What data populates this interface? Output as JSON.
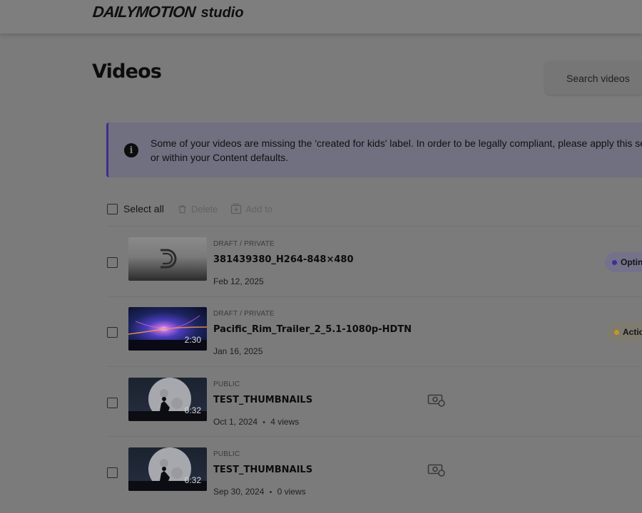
{
  "header": {
    "brand": "DAILYMOTION",
    "product": "studio"
  },
  "page": {
    "title": "Videos"
  },
  "search": {
    "placeholder": "Search videos"
  },
  "banner": {
    "icon": "info-icon",
    "text_line1": "Some of your videos are missing the 'created for kids' label. In order to be legally compliant, please apply this set",
    "text_line2": "or within your Content defaults."
  },
  "toolbar": {
    "select_all": "Select all",
    "delete": "Delete",
    "add_to": "Add to"
  },
  "videos": [
    {
      "status": "DRAFT / PRIVATE",
      "title": "381439380_H264-848×480",
      "date": "Feb 12, 2025",
      "views": "",
      "duration": "",
      "badge": "Optin",
      "badge_color": "#3b2f9e",
      "thumbnail": "dailymotion-placeholder"
    },
    {
      "status": "DRAFT / PRIVATE",
      "title": "Pacific_Rim_Trailer_2_5.1-1080p-HDTN",
      "date": "Jan 16, 2025",
      "views": "",
      "duration": "2:30",
      "badge": "Actio",
      "badge_color": "#c8951f",
      "thumbnail": "blue-explosion"
    },
    {
      "status": "PUBLIC",
      "title": "TEST_THUMBNAILS",
      "date": "Oct 1, 2024",
      "views": "4 views",
      "duration": "0:32",
      "badge": "",
      "thumbnail": "moon-silhouette",
      "monetization_icon": "monetization-icon"
    },
    {
      "status": "PUBLIC",
      "title": "TEST_THUMBNAILS",
      "date": "Sep 30, 2024",
      "views": "0 views",
      "duration": "0:32",
      "badge": "",
      "thumbnail": "moon-silhouette",
      "monetization_icon": "monetization-icon"
    }
  ],
  "meta_separator": "•"
}
